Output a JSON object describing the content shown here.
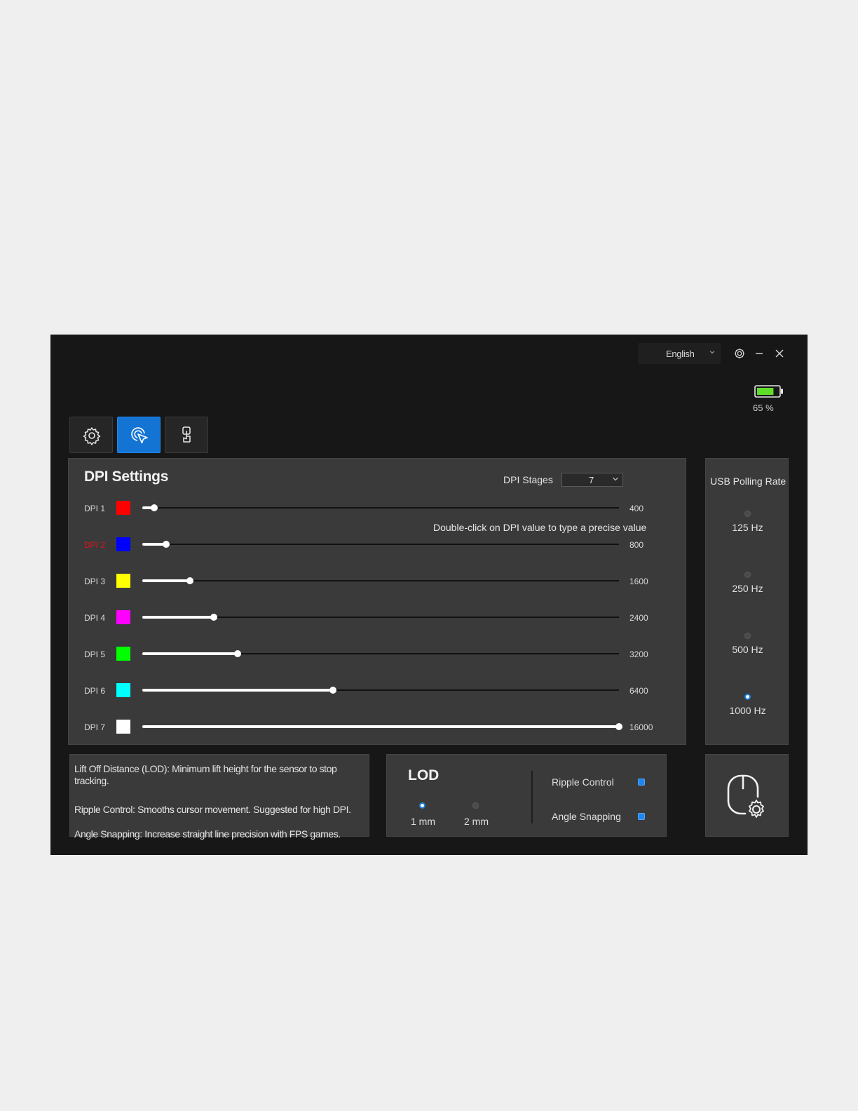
{
  "header": {
    "language": "English",
    "battery_percent": "65 %",
    "battery_level": 0.65,
    "battery_color": "#5fdd2a"
  },
  "tabs": [
    {
      "name": "settings",
      "icon": "gear-icon",
      "active": false
    },
    {
      "name": "dpi",
      "icon": "cursor-click-icon",
      "active": true
    },
    {
      "name": "buttons",
      "icon": "touch-hand-icon",
      "active": false
    }
  ],
  "dpi": {
    "title": "DPI Settings",
    "stages_label": "DPI Stages",
    "stages_value": "7",
    "hint": "Double-click on DPI value to type a precise value",
    "max": 16000,
    "rows": [
      {
        "label": "DPI 1",
        "color": "#ff0000",
        "value": "400",
        "selected": false
      },
      {
        "label": "DPI 2",
        "color": "#0000ff",
        "value": "800",
        "selected": true
      },
      {
        "label": "DPI 3",
        "color": "#ffff00",
        "value": "1600",
        "selected": false
      },
      {
        "label": "DPI 4",
        "color": "#ff00ff",
        "value": "2400",
        "selected": false
      },
      {
        "label": "DPI 5",
        "color": "#00ff00",
        "value": "3200",
        "selected": false
      },
      {
        "label": "DPI 6",
        "color": "#00ffff",
        "value": "6400",
        "selected": false
      },
      {
        "label": "DPI 7",
        "color": "#ffffff",
        "value": "16000",
        "selected": false
      }
    ]
  },
  "polling": {
    "title": "USB Polling Rate",
    "options": [
      {
        "label": "125 Hz",
        "selected": false
      },
      {
        "label": "250 Hz",
        "selected": false
      },
      {
        "label": "500 Hz",
        "selected": false
      },
      {
        "label": "1000 Hz",
        "selected": true
      }
    ]
  },
  "info": {
    "lod_text": "Lift Off Distance (LOD): Minimum lift height for the sensor to stop tracking.",
    "ripple_text": "Ripple Control: Smooths cursor movement. Suggested for high DPI.",
    "angle_text": "Angle Snapping: Increase straight line precision with FPS games."
  },
  "lod": {
    "title": "LOD",
    "options": [
      {
        "label": "1 mm",
        "selected": true
      },
      {
        "label": "2 mm",
        "selected": false
      }
    ],
    "ripple_label": "Ripple Control",
    "ripple_on": true,
    "angle_label": "Angle Snapping",
    "angle_on": true
  },
  "accent_color": "#1474d4"
}
